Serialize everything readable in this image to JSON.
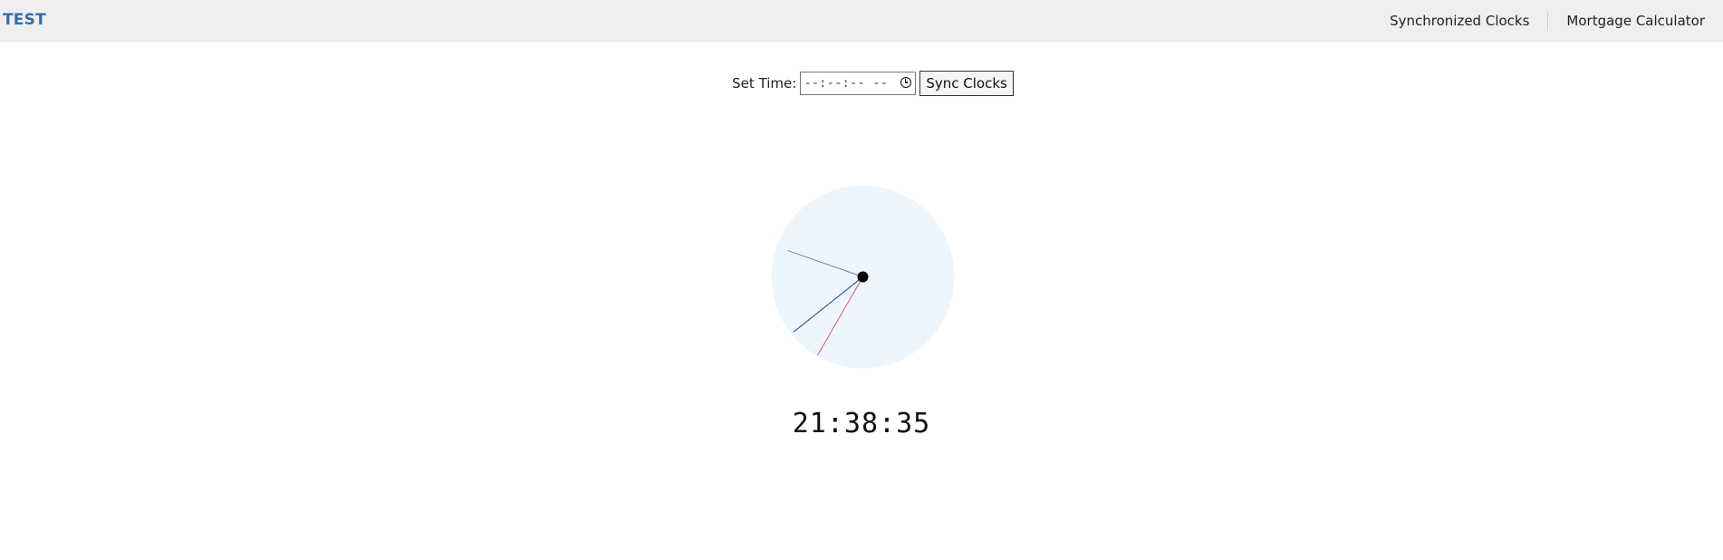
{
  "header": {
    "brand": "TEST",
    "nav": [
      {
        "label": "Synchronized Clocks"
      },
      {
        "label": "Mortgage Calculator"
      }
    ]
  },
  "controls": {
    "set_time_label": "Set Time:",
    "time_value": "--:--:-- --",
    "sync_label": "Sync Clocks"
  },
  "clock": {
    "hours": 21,
    "minutes": 38,
    "seconds": 35,
    "face_color": "#eef6fd",
    "second_hand_color": "#e05b5b",
    "minute_hand_color": "#3a5ea8",
    "hour_hand_color": "#6f84a8"
  },
  "digital": {
    "time": "21:38:35"
  }
}
